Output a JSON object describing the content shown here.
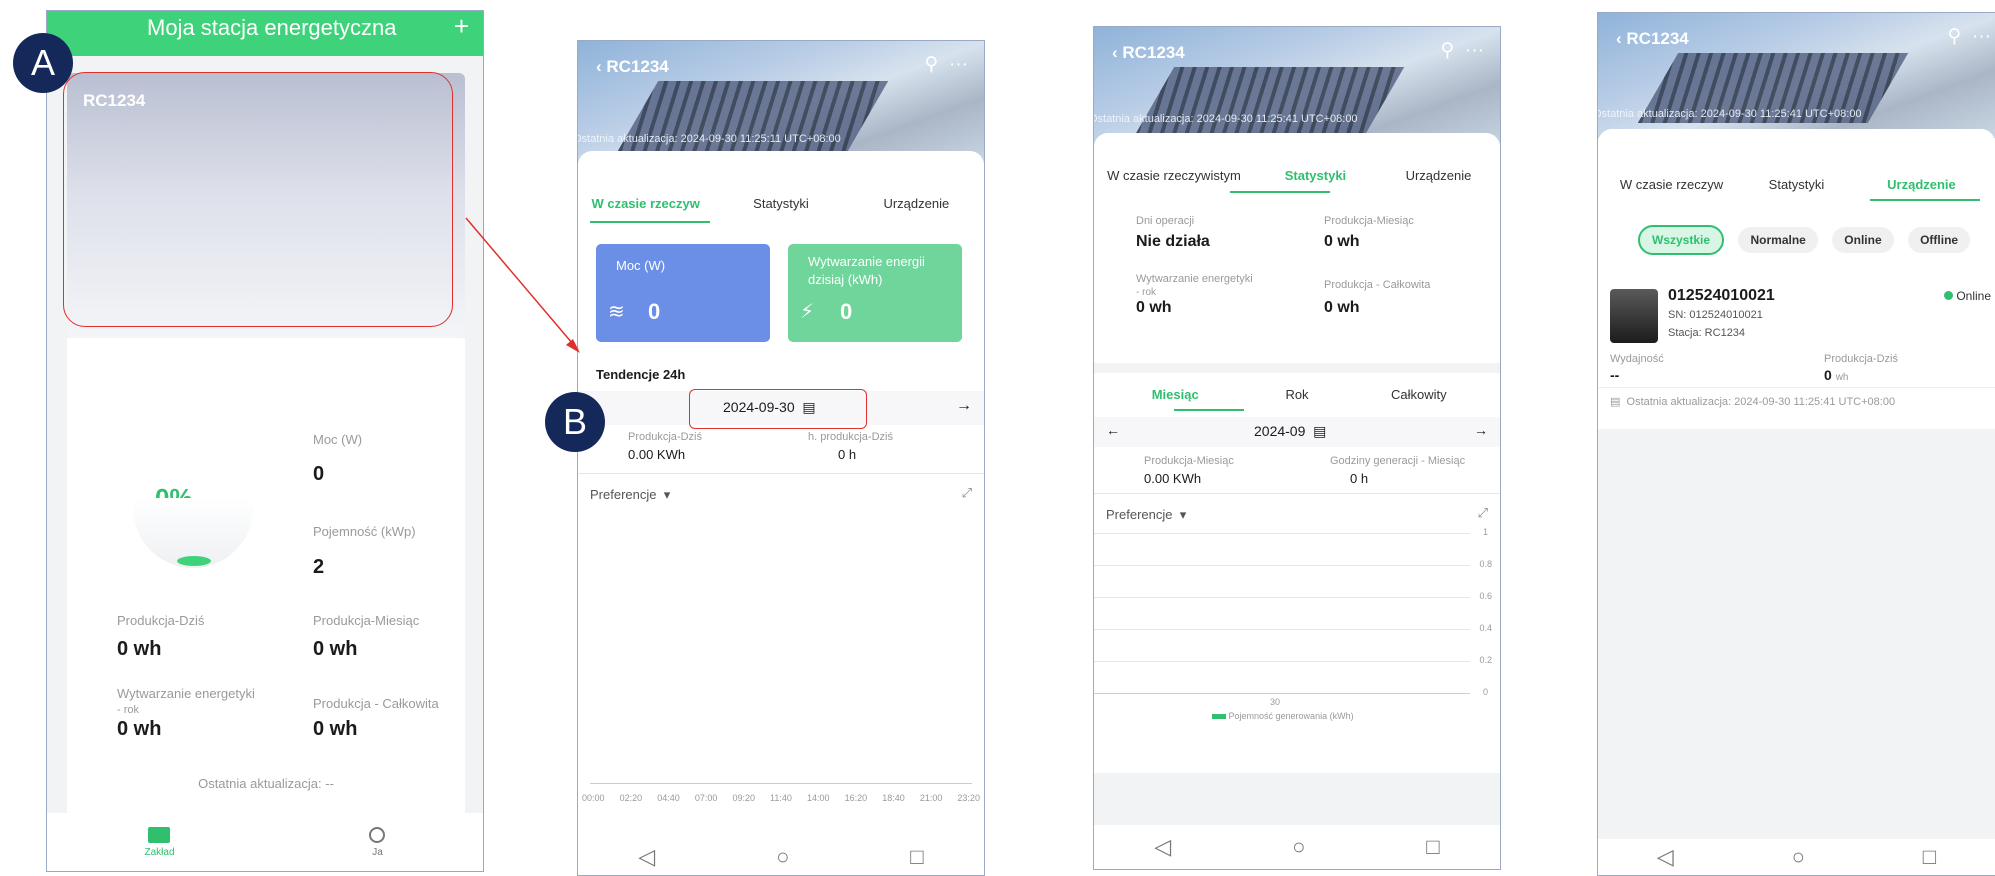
{
  "labels": {
    "a": "A",
    "b": "B"
  },
  "screen_a": {
    "header_title": "Moja stacja energetyczna",
    "add_icon": "+",
    "station_name": "RC1234",
    "percent": "0%",
    "moc_label": "Moc (W)",
    "moc_value": "0",
    "pojemnosc_label": "Pojemność (kWp)",
    "pojemnosc_value": "2",
    "prod_dzis_label": "Produkcja-Dziś",
    "prod_dzis_value": "0 wh",
    "prod_miesiac_label": "Produkcja-Miesiąc",
    "prod_miesiac_value": "0 wh",
    "wytw_label_1": "Wytwarzanie energetyki",
    "wytw_label_2": "- rok",
    "wytw_value": "0 wh",
    "prod_calk_label": "Produkcja - Całkowita",
    "prod_calk_value": "0 wh",
    "ostatnia": "Ostatnia aktualizacja:  --",
    "nav_home": "Zakład",
    "nav_me": "Ja"
  },
  "screen_b": {
    "title": "RC1234",
    "update": "Ostatnia aktualizacja:  2024-09-30 11:25:11 UTC+08:00",
    "tabs": [
      "W czasie rzeczyw",
      "Statystyki",
      "Urządzenie"
    ],
    "card1_label": "Moc (W)",
    "card1_value": "0",
    "card2_label_1": "Wytwarzanie energii",
    "card2_label_2": "dzisiaj (kWh)",
    "card2_value": "0",
    "tendencje": "Tendencje 24h",
    "date": "2024-09-30",
    "prod_label": "Produkcja-Dziś",
    "prod_value": "0.00 KWh",
    "h_label": "h. produkcja-Dziś",
    "h_value": "0 h",
    "preferencje": "Preferencje",
    "axis": [
      "00:00",
      "02:20",
      "04:40",
      "07:00",
      "09:20",
      "11:40",
      "14:00",
      "16:20",
      "18:40",
      "21:00",
      "23:20"
    ]
  },
  "screen_c": {
    "title": "RC1234",
    "update": "Ostatnia aktualizacja:  2024-09-30 11:25:41 UTC+08:00",
    "tabs": [
      "W czasie rzeczywistym",
      "Statystyki",
      "Urządzenie"
    ],
    "dni_label": "Dni operacji",
    "dni_value": "Nie działa",
    "pm_label": "Produkcja-Miesiąc",
    "pm_value": "0 wh",
    "wr_label_1": "Wytwarzanie energetyki",
    "wr_label_2": "- rok",
    "wr_value": "0 wh",
    "pc_label": "Produkcja - Całkowita",
    "pc_value": "0 wh",
    "period_tabs": [
      "Miesiąc",
      "Rok",
      "Całkowity"
    ],
    "month": "2024-09",
    "prod_label": "Produkcja-Miesiąc",
    "prod_value": "0.00 KWh",
    "godz_label": "Godziny generacji - Miesiąc",
    "godz_value": "0 h",
    "preferencje": "Preferencje",
    "y_ticks": [
      "1",
      "0.8",
      "0.6",
      "0.4",
      "0.2",
      "0"
    ],
    "x_tick": "30",
    "legend": "Pojemność generowania (kWh)"
  },
  "screen_d": {
    "title": "RC1234",
    "update": "Ostatnia aktualizacja:  2024-09-30 11:25:41 UTC+08:00",
    "tabs": [
      "W czasie rzeczyw",
      "Statystyki",
      "Urządzenie"
    ],
    "chips": [
      "Wszystkie",
      "Normalne",
      "Online",
      "Offline"
    ],
    "device_id": "012524010021",
    "sn": "SN: 012524010021",
    "stacja": "Stacja:  RC1234",
    "status": "Online",
    "wyd_label": "Wydajność",
    "wyd_value": "--",
    "pd_label": "Produkcja-Dziś",
    "pd_value": "0",
    "pd_unit": "wh",
    "update_row": "Ostatnia aktualizacja: 2024-09-30 11:25:41 UTC+08:00"
  }
}
